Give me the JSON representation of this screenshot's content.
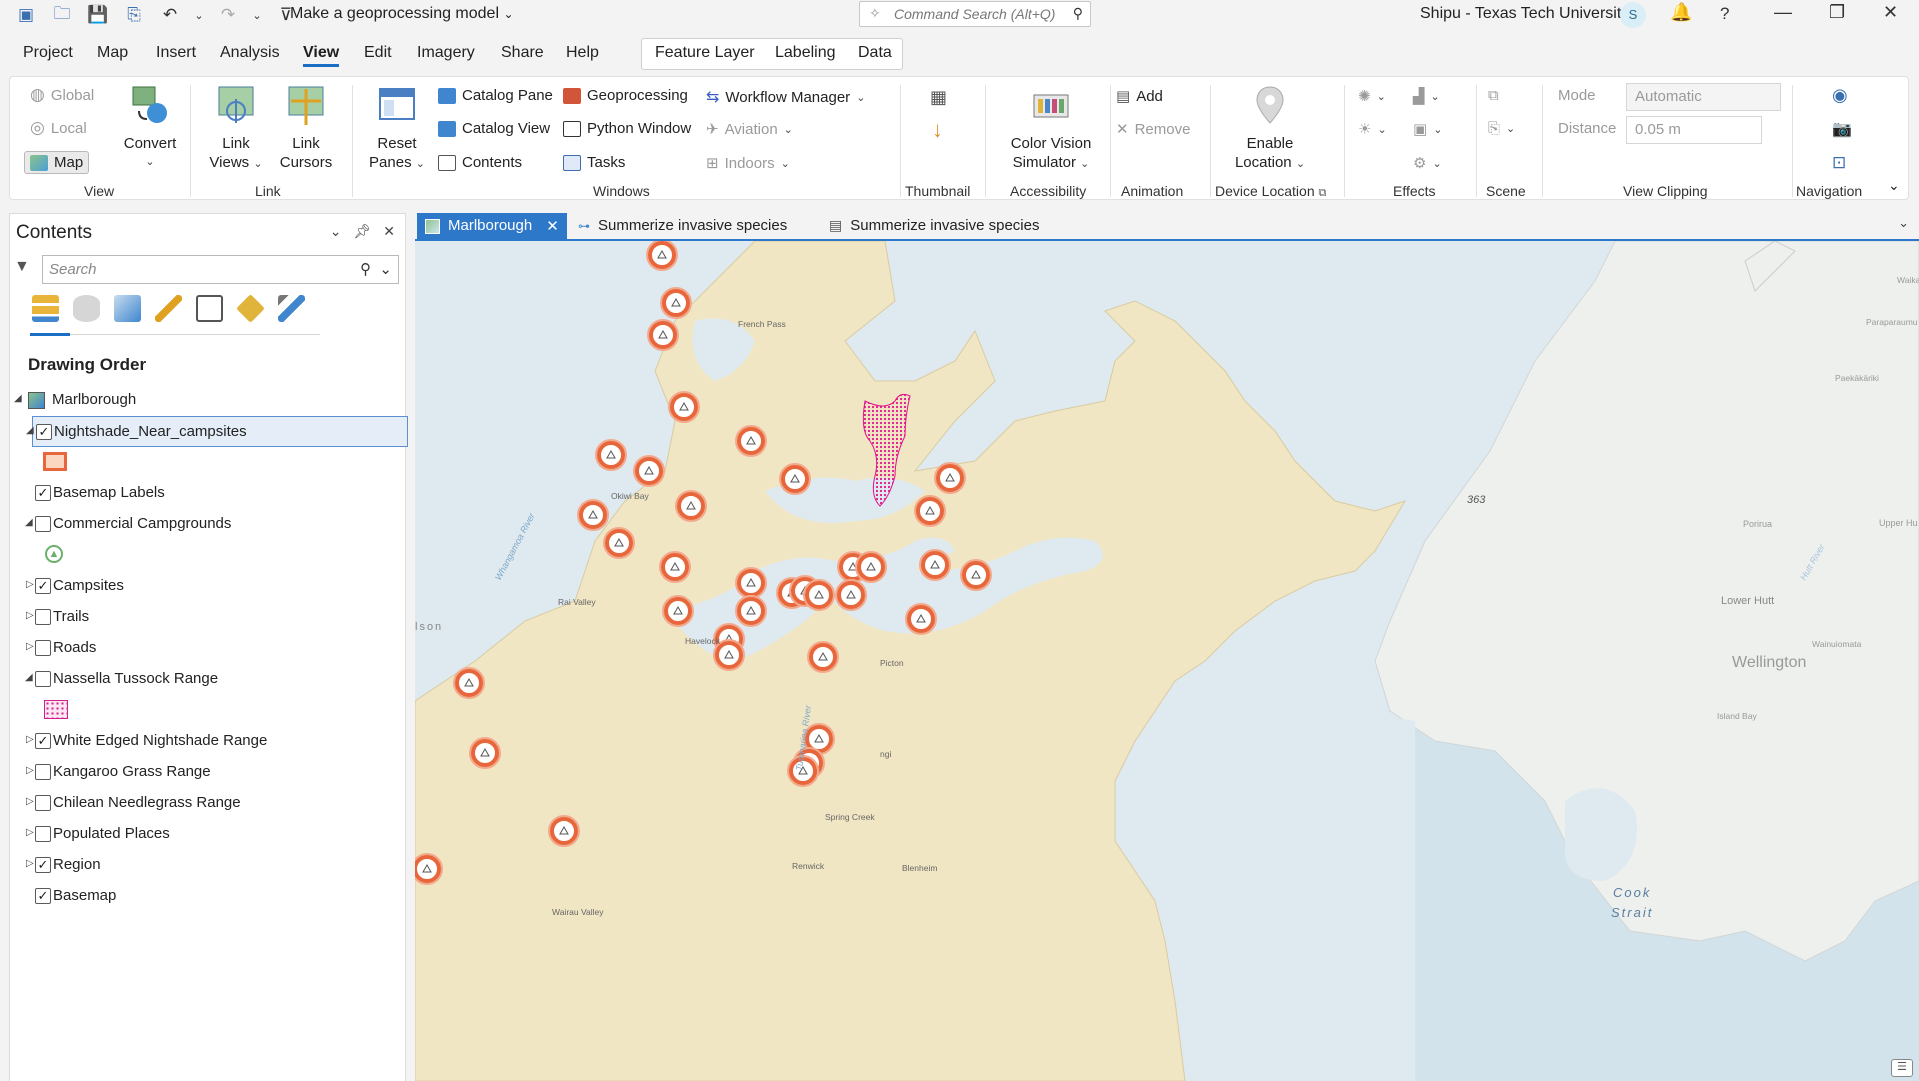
{
  "title_bar": {
    "doc_title": "Make a geoprocessing model",
    "command_search_placeholder": "Command Search (Alt+Q)",
    "user": "Shipu - Texas Tech University",
    "avatar_initial": "S",
    "help": "?"
  },
  "menu": {
    "tabs": [
      "Project",
      "Map",
      "Insert",
      "Analysis",
      "View",
      "Edit",
      "Imagery",
      "Share",
      "Help"
    ],
    "active": "View",
    "context_tabs": [
      "Feature Layer",
      "Labeling",
      "Data"
    ]
  },
  "ribbon": {
    "view_group": {
      "global": "Global",
      "local": "Local",
      "map": "Map",
      "convert": "Convert",
      "label": "View"
    },
    "link_group": {
      "link_views_1": "Link",
      "link_views_2": "Views",
      "link_cursors_1": "Link",
      "link_cursors_2": "Cursors",
      "label": "Link"
    },
    "windows_group": {
      "reset_panes_1": "Reset",
      "reset_panes_2": "Panes",
      "catalog_pane": "Catalog Pane",
      "catalog_view": "Catalog View",
      "contents": "Contents",
      "geoprocessing": "Geoprocessing",
      "python_window": "Python Window",
      "tasks": "Tasks",
      "workflow_manager": "Workflow Manager",
      "aviation": "Aviation",
      "indoors": "Indoors",
      "label": "Windows"
    },
    "thumbnail_label": "Thumbnail",
    "accessibility": {
      "btn_1": "Color Vision",
      "btn_2": "Simulator",
      "label": "Accessibility"
    },
    "animation": {
      "add": "Add",
      "remove": "Remove",
      "label": "Animation"
    },
    "device_location": {
      "btn_1": "Enable",
      "btn_2": "Location",
      "label": "Device Location"
    },
    "effects_label": "Effects",
    "scene_label": "Scene",
    "view_clipping": {
      "mode_label": "Mode",
      "mode_value": "Automatic",
      "distance_label": "Distance",
      "distance_value": "0.05  m",
      "label": "View Clipping"
    },
    "navigation_label": "Navigation"
  },
  "contents_pane": {
    "title": "Contents",
    "search_placeholder": "Search",
    "section": "Drawing Order",
    "map_name": "Marlborough",
    "layers": [
      {
        "name": "Nightshade_Near_campsites",
        "checked": true,
        "expanded": true,
        "selected": true
      },
      {
        "name": "Basemap Labels",
        "checked": true,
        "expanded": null
      },
      {
        "name": "Commercial Campgrounds",
        "checked": false,
        "expanded": true
      },
      {
        "name": "Campsites",
        "checked": true,
        "expanded": false
      },
      {
        "name": "Trails",
        "checked": false,
        "expanded": false
      },
      {
        "name": "Roads",
        "checked": false,
        "expanded": false
      },
      {
        "name": "Nassella Tussock Range",
        "checked": false,
        "expanded": true
      },
      {
        "name": "White Edged Nightshade Range",
        "checked": true,
        "expanded": false
      },
      {
        "name": "Kangaroo Grass Range",
        "checked": false,
        "expanded": false
      },
      {
        "name": "Chilean Needlegrass Range",
        "checked": false,
        "expanded": false
      },
      {
        "name": "Populated Places",
        "checked": false,
        "expanded": false
      },
      {
        "name": "Region",
        "checked": true,
        "expanded": false
      },
      {
        "name": "Basemap",
        "checked": true,
        "expanded": null
      }
    ]
  },
  "map_tabs": [
    {
      "label": "Marlborough",
      "active": true
    },
    {
      "label": "Summerize invasive species",
      "active": false
    },
    {
      "label": "Summerize invasive species",
      "active": false
    }
  ],
  "map_labels": {
    "french_pass": "French Pass",
    "okiwi_bay": "Okiwi Bay",
    "rai_valley": "Rai Valley",
    "havelock": "Havelock",
    "picton": "Picton",
    "tuamarina_river": "Tuamarina River",
    "spring_creek": "Spring Creek",
    "renwick": "Renwick",
    "blenheim": "Blenheim",
    "wairau_valley": "Wairau Valley",
    "whangamoa_river": "Whangamoa River",
    "nelson_partial": "lson",
    "cook_strait_1": "Cook",
    "cook_strait_2": "Strait",
    "wellington": "Wellington",
    "lower_hutt": "Lower Hutt",
    "porirua": "Porirua",
    "upper_hutt": "Upper Hu",
    "hutt_river": "Hutt River",
    "paekakariki": "Paekākāriki",
    "paraparaumu": "Paraparaumu",
    "waikanae": "Waikanae",
    "wainuiomata": "Wainuiomata",
    "island_bay": "Island Bay",
    "highway": "363",
    "seddon_partial": "ngi"
  },
  "colors": {
    "accent": "#1a6fc4",
    "land": "#f1e6c3",
    "water": "#dde9ee",
    "campsite_ring": "#e8663b",
    "nightshade": "#e0148c"
  }
}
